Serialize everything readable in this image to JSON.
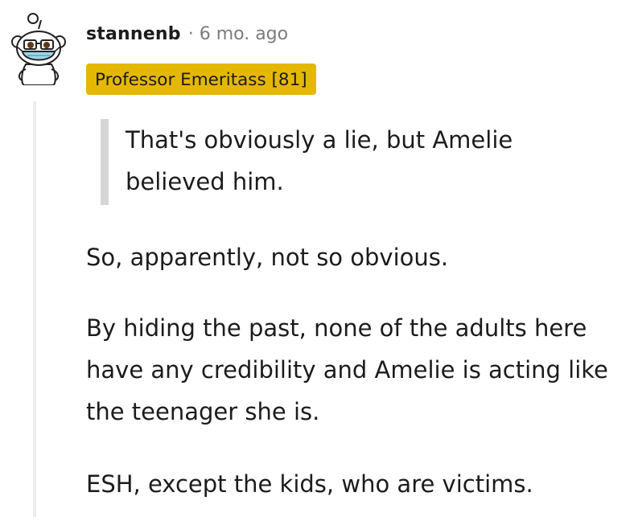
{
  "comment": {
    "username": "stannenb",
    "separator": "·",
    "timestamp": "6 mo. ago",
    "flair": "Professor Emeritass [81]",
    "quote": "That's obviously a lie, but Amelie believed him.",
    "paragraphs": [
      "So, apparently, not so obvious.",
      "By hiding the past, none of the adults here have any credibility and Amelie is acting like the teenager she is.",
      "ESH, except the kids, who are victims."
    ]
  },
  "colors": {
    "flair_background": "#e4b800",
    "timestamp": "#7c7c7c",
    "text": "#1c1c1c",
    "mask": "#9fd6e6"
  },
  "icons": {
    "avatar": "snoo-avatar-with-mask"
  }
}
